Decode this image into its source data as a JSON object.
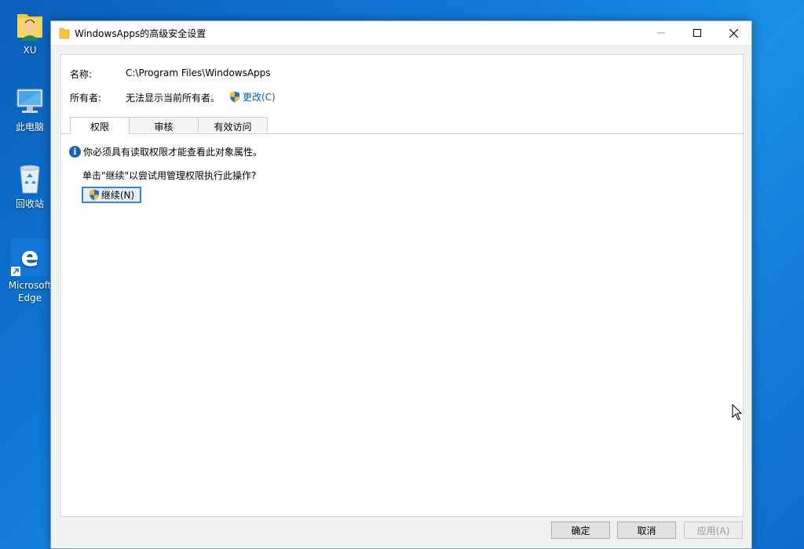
{
  "desktop": {
    "icons": [
      {
        "label": "XU"
      },
      {
        "label": "此电脑"
      },
      {
        "label": "回收站"
      },
      {
        "label": "Microsoft Edge"
      }
    ]
  },
  "window": {
    "title": "WindowsApps的高级安全设置",
    "properties": {
      "name_label": "名称:",
      "name_value": "C:\\Program Files\\WindowsApps",
      "owner_label": "所有者:",
      "owner_value": "无法显示当前所有者。",
      "change_link": "更改(C)"
    },
    "tabs": [
      {
        "label": "权限",
        "active": true
      },
      {
        "label": "审核",
        "active": false
      },
      {
        "label": "有效访问",
        "active": false
      }
    ],
    "notice": "你必须具有读取权限才能查看此对象属性。",
    "instruction": "单击\"继续\"以尝试用管理权限执行此操作?",
    "continue_button": "继续(N)",
    "buttons": {
      "ok": "确定",
      "cancel": "取消",
      "apply": "应用(A)"
    }
  },
  "colors": {
    "desktop_bg": "#0f78d6",
    "link": "#0a5ea8",
    "info_icon": "#1e5fb3",
    "focus_border": "#3c7fd1"
  }
}
